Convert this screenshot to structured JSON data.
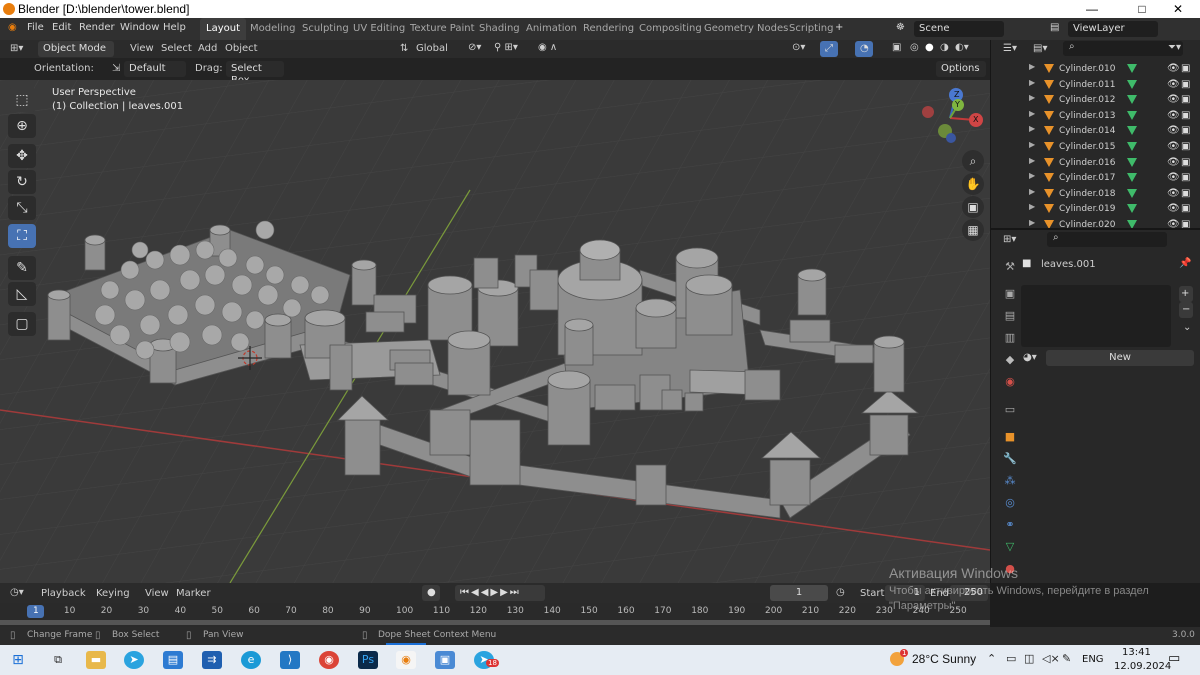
{
  "window": {
    "title": "Blender [D:\\blender\\tower.blend]",
    "minimize": "—",
    "maximize": "□",
    "close": "✕"
  },
  "menu": {
    "items": [
      "File",
      "Edit",
      "Render",
      "Window",
      "Help"
    ]
  },
  "workspaces": {
    "active": "Layout",
    "items": [
      "Layout",
      "Modeling",
      "Sculpting",
      "UV Editing",
      "Texture Paint",
      "Shading",
      "Animation",
      "Rendering",
      "Compositing",
      "Geometry Nodes",
      "Scripting"
    ],
    "add": "+"
  },
  "scene": {
    "label": "Scene",
    "viewlayer": "ViewLayer"
  },
  "header": {
    "mode": "Object Mode",
    "view": "View",
    "select": "Select",
    "add": "Add",
    "object": "Object",
    "transform": "Global"
  },
  "tool_settings": {
    "orientation_label": "Orientation:",
    "orientation": "Default",
    "drag_label": "Drag:",
    "drag": "Select Box",
    "options": "Options"
  },
  "viewport": {
    "perspective": "User Perspective",
    "collection": "(1) Collection | leaves.001"
  },
  "gizmo": {
    "x": "X",
    "y": "Y",
    "z": "Z"
  },
  "outliner": {
    "rows": [
      "Cylinder.010",
      "Cylinder.011",
      "Cylinder.012",
      "Cylinder.013",
      "Cylinder.014",
      "Cylinder.015",
      "Cylinder.016",
      "Cylinder.017",
      "Cylinder.018",
      "Cylinder.019",
      "Cylinder.020"
    ]
  },
  "properties": {
    "object_name": "leaves.001",
    "new_button": "New"
  },
  "timeline": {
    "playback": "Playback",
    "keying": "Keying",
    "view": "View",
    "marker": "Marker",
    "current_frame": "1",
    "start_label": "Start",
    "start": "1",
    "end_label": "End",
    "end": "250",
    "ticks": [
      "1",
      "10",
      "20",
      "30",
      "40",
      "50",
      "60",
      "70",
      "80",
      "90",
      "100",
      "110",
      "120",
      "130",
      "140",
      "150",
      "160",
      "170",
      "180",
      "190",
      "200",
      "210",
      "220",
      "230",
      "240",
      "250"
    ]
  },
  "status": {
    "change_frame": "Change Frame",
    "box_select": "Box Select",
    "pan_view": "Pan View",
    "context_menu": "Dope Sheet Context Menu",
    "version": "3.0.0"
  },
  "watermark": {
    "line1": "Активация Windows",
    "line2": "Чтобы активировать Windows, перейдите в раздел",
    "line3": "\"Параметры\"."
  },
  "taskbar": {
    "weather": "28°C  Sunny",
    "lang": "ENG",
    "time": "13:41",
    "date": "12.09.2024",
    "notif": "18",
    "weather_badge": "1"
  },
  "colors": {
    "accent": "#4772b3",
    "object_icon": "#e8922a",
    "mesh_icon": "#3fbb6a",
    "grid_x": "#a03a3a",
    "grid_y": "#7a9a3a"
  }
}
